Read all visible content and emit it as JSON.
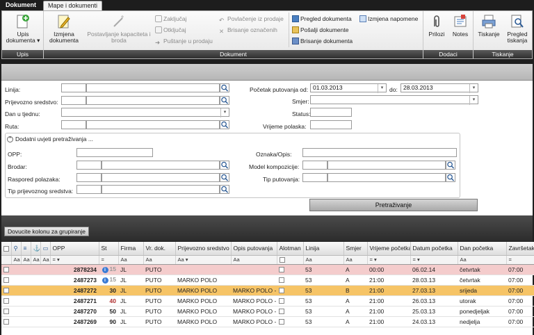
{
  "tabs": [
    {
      "label": "Dokument"
    },
    {
      "label": "Mape i dokumenti"
    }
  ],
  "ribbon": {
    "upis": {
      "btn": "Upis dokumenta ▾",
      "footer": "Upis"
    },
    "dokument": {
      "izmjena": "Izmjena dokumenta",
      "postavljanje": "Postavljanje kapaciteta i broda",
      "zakljucaj": "Zaključaj",
      "otkljucaj": "Otključaj",
      "pustanje": "Puštanje u prodaju",
      "povlacenje": "Povlačenje iz prodaje",
      "brisanje_oznacenih": "Brisanje označenih",
      "pregled": "Pregled dokumenta",
      "posalji": "Pošalji dokumente",
      "brisanje_dok": "Brisanje dokumenta",
      "izmjena_napomene": "Izmjena napomene",
      "footer": "Dokument"
    },
    "dodaci": {
      "prilozi": "Prilozi",
      "notes": "Notes",
      "footer": "Dodaci"
    },
    "tiskanje": {
      "tiskanje": "Tiskanje",
      "pregled": "Pregled tiskanja",
      "footer": "Tiskanje"
    }
  },
  "filter": {
    "linija": "Linija:",
    "prijevozno": "Prijevozno sredstvo:",
    "dan": "Dan u tjednu:",
    "ruta": "Ruta:",
    "pocetak_od": "Početak putovanja od:",
    "od_value": "01.03.2013",
    "do": "do:",
    "do_value": "28.03.2013",
    "smjer": "Smjer:",
    "status": "Status:",
    "vrijeme": "Vrijeme polaska:",
    "dodatni": "Dodatni uvjeti pretraživanja ...",
    "opp": "OPP:",
    "brodar": "Brodar:",
    "raspored": "Raspored polazaka:",
    "tip_prijevoznog": "Tip prijevoznog sredstva:",
    "oznaka": "Oznaka/Opis:",
    "model": "Model kompozicije:",
    "tip_putovanja": "Tip putovanja:",
    "search_btn": "Pretraživanje"
  },
  "group_btn": "Dovucite kolonu za grupiranje",
  "grid": {
    "columns": [
      "OPP",
      "St",
      "Firma",
      "Vr. dok.",
      "Prijevozno sredstvo",
      "Opis putovanja",
      "Alotman",
      "Linija",
      "Smjer",
      "Vrijeme početka",
      "Datum početka",
      "Dan početka",
      "Završetak"
    ],
    "rows": [
      {
        "opp": "2878234",
        "st": "15",
        "firma": "JL",
        "vrdok": "PUTO",
        "prijevozno": "",
        "opis": "",
        "linija": "53",
        "smjer": "A",
        "vrijeme": "00:00",
        "datum": "06.02.14",
        "dan": "četvrtak",
        "zavrsetak": "07:00",
        "style": "r-pink",
        "stc": "gray",
        "info": "true"
      },
      {
        "opp": "2487273",
        "st": "15",
        "firma": "JL",
        "vrdok": "PUTO",
        "prijevozno": "MARKO POLO",
        "opis": "",
        "linija": "53",
        "smjer": "A",
        "vrijeme": "21:00",
        "datum": "28.03.13",
        "dan": "četvrtak",
        "zavrsetak": "07:00",
        "style": "",
        "stc": "gray",
        "info": "true"
      },
      {
        "opp": "2487272",
        "st": "30",
        "firma": "JL",
        "vrdok": "PUTO",
        "prijevozno": "MARKO POLO",
        "opis": "MARKO POLO - !",
        "linija": "53",
        "smjer": "B",
        "vrijeme": "21:00",
        "datum": "27.03.13",
        "dan": "srijeda",
        "zavrsetak": "07:00",
        "style": "r-sel",
        "stc": "",
        "info": ""
      },
      {
        "opp": "2487271",
        "st": "40",
        "firma": "JL",
        "vrdok": "PUTO",
        "prijevozno": "MARKO POLO",
        "opis": "MARKO POLO - !",
        "linija": "53",
        "smjer": "A",
        "vrijeme": "21:00",
        "datum": "26.03.13",
        "dan": "utorak",
        "zavrsetak": "07:00",
        "style": "",
        "stc": "red",
        "info": ""
      },
      {
        "opp": "2487270",
        "st": "50",
        "firma": "JL",
        "vrdok": "PUTO",
        "prijevozno": "MARKO POLO",
        "opis": "MARKO POLO - !",
        "linija": "53",
        "smjer": "A",
        "vrijeme": "21:00",
        "datum": "25.03.13",
        "dan": "ponedjeljak",
        "zavrsetak": "07:00",
        "style": "",
        "stc": "",
        "info": ""
      },
      {
        "opp": "2487269",
        "st": "90",
        "firma": "JL",
        "vrdok": "PUTO",
        "prijevozno": "MARKO POLO",
        "opis": "MARKO POLO - !",
        "linija": "53",
        "smjer": "A",
        "vrijeme": "21:00",
        "datum": "24.03.13",
        "dan": "nedjelja",
        "zavrsetak": "07:00",
        "style": "",
        "stc": "",
        "info": ""
      }
    ]
  }
}
